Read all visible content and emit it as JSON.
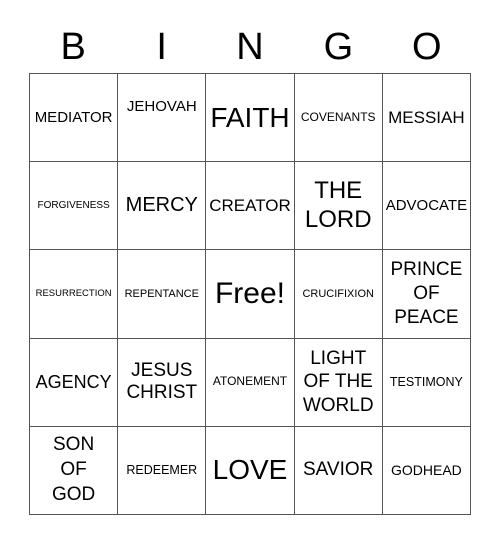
{
  "header": {
    "letters": [
      "B",
      "I",
      "N",
      "G",
      "O"
    ]
  },
  "board": {
    "rows": [
      [
        "MEDIATOR",
        "JEHOVAH",
        "FAITH",
        "COVENANTS",
        "MESSIAH"
      ],
      [
        "FORGIVENESS",
        "MERCY",
        "CREATOR",
        "THE LORD",
        "ADVOCATE"
      ],
      [
        "RESURRECTION",
        "REPENTANCE",
        "Free!",
        "CRUCIFIXION",
        "PRINCE OF PEACE"
      ],
      [
        "AGENCY",
        "JESUS CHRIST",
        "ATONEMENT",
        "LIGHT OF THE WORLD",
        "TESTIMONY"
      ],
      [
        "SON OF GOD",
        "REDEEMER",
        "LOVE",
        "SAVIOR",
        "GODHEAD"
      ]
    ],
    "free_space": "Free!"
  }
}
